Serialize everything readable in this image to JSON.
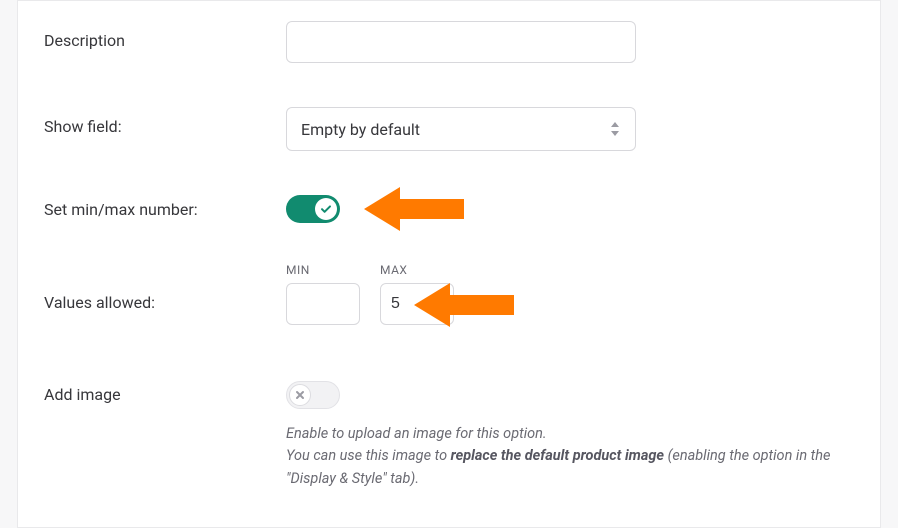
{
  "fields": {
    "description_label": "Description",
    "description_value": "",
    "showfield_label": "Show field:",
    "showfield_value": "Empty by default",
    "minmax_label": "Set min/max number:",
    "minmax_on": true,
    "values_label": "Values allowed:",
    "min_caption": "MIN",
    "max_caption": "MAX",
    "min_value": "",
    "max_value": "5",
    "addimage_label": "Add image",
    "addimage_on": false,
    "addimage_help_1": "Enable to upload an image for this option.",
    "addimage_help_2a": "You can use this image to ",
    "addimage_help_2b": "replace the default product image",
    "addimage_help_2c": " (enabling the option in the \"Display & Style\" tab)."
  },
  "colors": {
    "accent": "#118b6f",
    "arrow": "#ff7a00"
  }
}
